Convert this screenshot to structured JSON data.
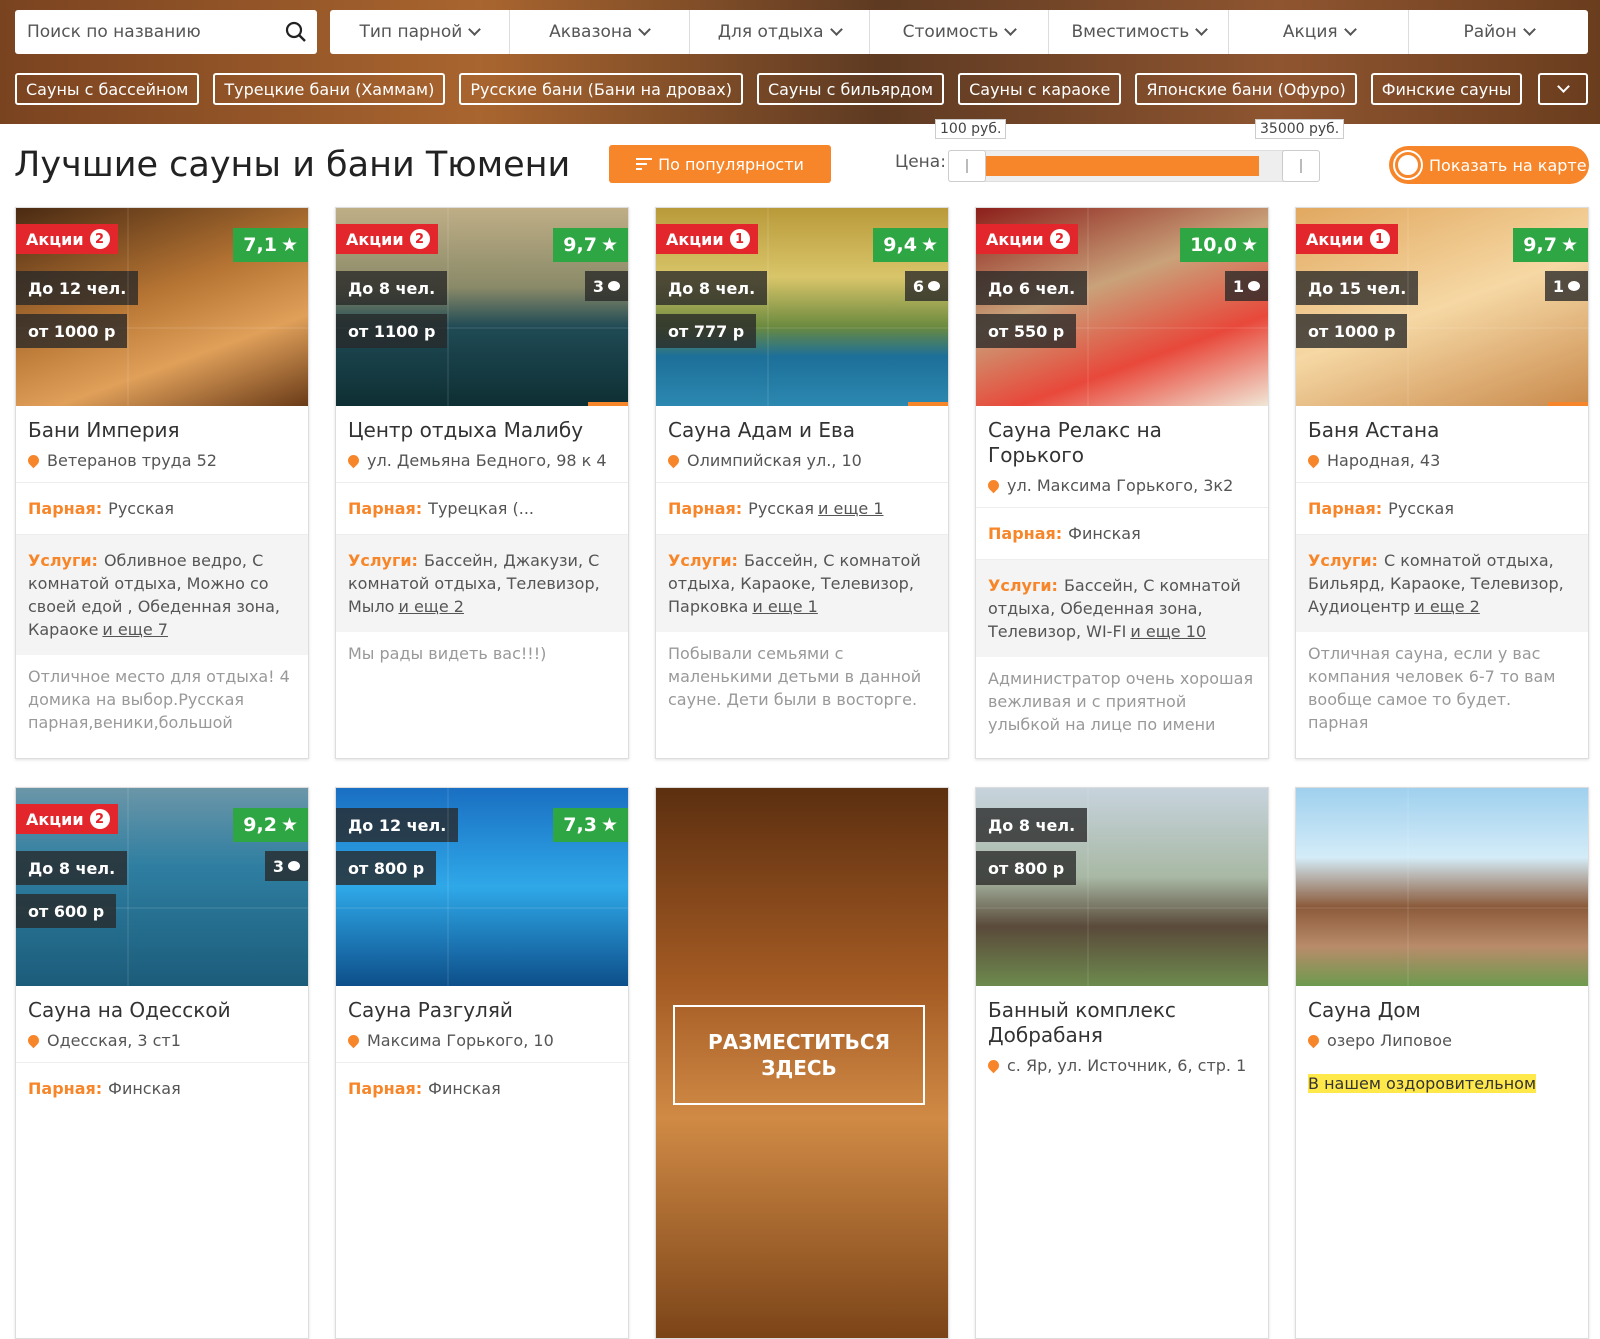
{
  "search": {
    "placeholder": "Поиск по названию"
  },
  "filters": [
    "Тип парной",
    "Аквазона",
    "Для отдыха",
    "Стоимость",
    "Вместимость",
    "Акция",
    "Район"
  ],
  "tags": [
    "Сауны с бассейном",
    "Турецкие бани (Хаммам)",
    "Русские бани (Бани на дровах)",
    "Сауны с бильярдом",
    "Сауны с караоке",
    "Японские бани (Офуро)",
    "Финские сауны"
  ],
  "title": "Лучшие сауны и бани Тюмени",
  "sort_label": "По популярности",
  "price": {
    "label": "Цена:",
    "min": "100 руб.",
    "max": "35000 руб."
  },
  "map_toggle": "Показать на карте",
  "labels": {
    "room": "Парная:",
    "services": "Услуги:"
  },
  "cards": [
    {
      "name": "Бани Империя",
      "address": "Ветеранов труда 52",
      "promo": "Акции",
      "promo_n": "2",
      "rating": "7,1",
      "cap": "До 12 чел.",
      "price": "от 1000 р",
      "reviews": "",
      "room": "Русская",
      "room_more": "",
      "services": "Обливное ведро, С комнатой отдыха, Можно со своей едой , Обеденная зона, Караоке",
      "services_more": "и еще 7",
      "review": "Отличное место для отдыха! 4 домика на выбор.Русская парная,веники,большой"
    },
    {
      "name": "Центр отдыха Малибу",
      "address": "ул. Демьяна Бедного, 98 к 4",
      "promo": "Акции",
      "promo_n": "2",
      "rating": "9,7",
      "cap": "До 8 чел.",
      "price": "от 1100 р",
      "reviews": "3",
      "room": "Турецкая (...",
      "room_more": "",
      "services": "Бассейн, Джакузи, С комнатой отдыха, Телевизор, Мыло",
      "services_more": "и еще 2",
      "review": "Мы рады видеть вас!!!)"
    },
    {
      "name": "Сауна Адам и Ева",
      "address": "Олимпийская ул., 10",
      "promo": "Акции",
      "promo_n": "1",
      "rating": "9,4",
      "cap": "До 8 чел.",
      "price": "от 777 р",
      "reviews": "6",
      "room": "Русская",
      "room_more": "и еще 1",
      "services": "Бассейн, С комнатой отдыха, Караоке, Телевизор, Парковка",
      "services_more": "и еще 1",
      "review": "Побывали семьями с маленькими детьми в данной сауне. Дети были в восторге."
    },
    {
      "name": "Сауна Релакс на Горького",
      "address": "ул. Максима Горького, 3к2",
      "promo": "Акции",
      "promo_n": "2",
      "rating": "10,0",
      "cap": "До 6 чел.",
      "price": "от 550 р",
      "reviews": "1",
      "room": "Финская",
      "room_more": "",
      "services": "Бассейн, С комнатой отдыха, Обеденная зона, Телевизор, WI-FI",
      "services_more": "и еще 10",
      "review": "Администратор очень хорошая вежливая и с приятной улыбкой на лице по имени"
    },
    {
      "name": "Баня Астана",
      "address": "Народная, 43",
      "promo": "Акции",
      "promo_n": "1",
      "rating": "9,7",
      "cap": "До 15 чел.",
      "price": "от 1000 р",
      "reviews": "1",
      "room": "Русская",
      "room_more": "",
      "services": "С комнатой отдыха, Бильярд, Караоке, Телевизор, Аудиоцентр",
      "services_more": "и еще 2",
      "review": "Отличная сауна, если у вас компания человек 6-7 то вам вообще самое то будет. парная"
    },
    {
      "name": "Сауна на Одесской",
      "address": "Одесская, 3 ст1",
      "promo": "Акции",
      "promo_n": "2",
      "rating": "9,2",
      "cap": "До 8 чел.",
      "price": "от 600 р",
      "reviews": "3",
      "room": "Финская"
    },
    {
      "name": "Сауна Разгуляй",
      "address": "Максима Горького, 10",
      "promo": "",
      "promo_n": "",
      "rating": "7,3",
      "cap": "До 12 чел.",
      "price": "от 800 р",
      "reviews": "",
      "room": "Финская"
    },
    {
      "promo_card": "РАЗМЕСТИТЬСЯ ЗДЕСЬ"
    },
    {
      "name": "Банный комплекс Добрабаня",
      "address": "с. Яр, ул. Источник, 6, стр. 1",
      "cap": "До 8 чел.",
      "price": "от 800 р"
    },
    {
      "name": "Сауна Дом",
      "address": "озеро Липовое",
      "highlight": "В нашем оздоровительном"
    }
  ]
}
